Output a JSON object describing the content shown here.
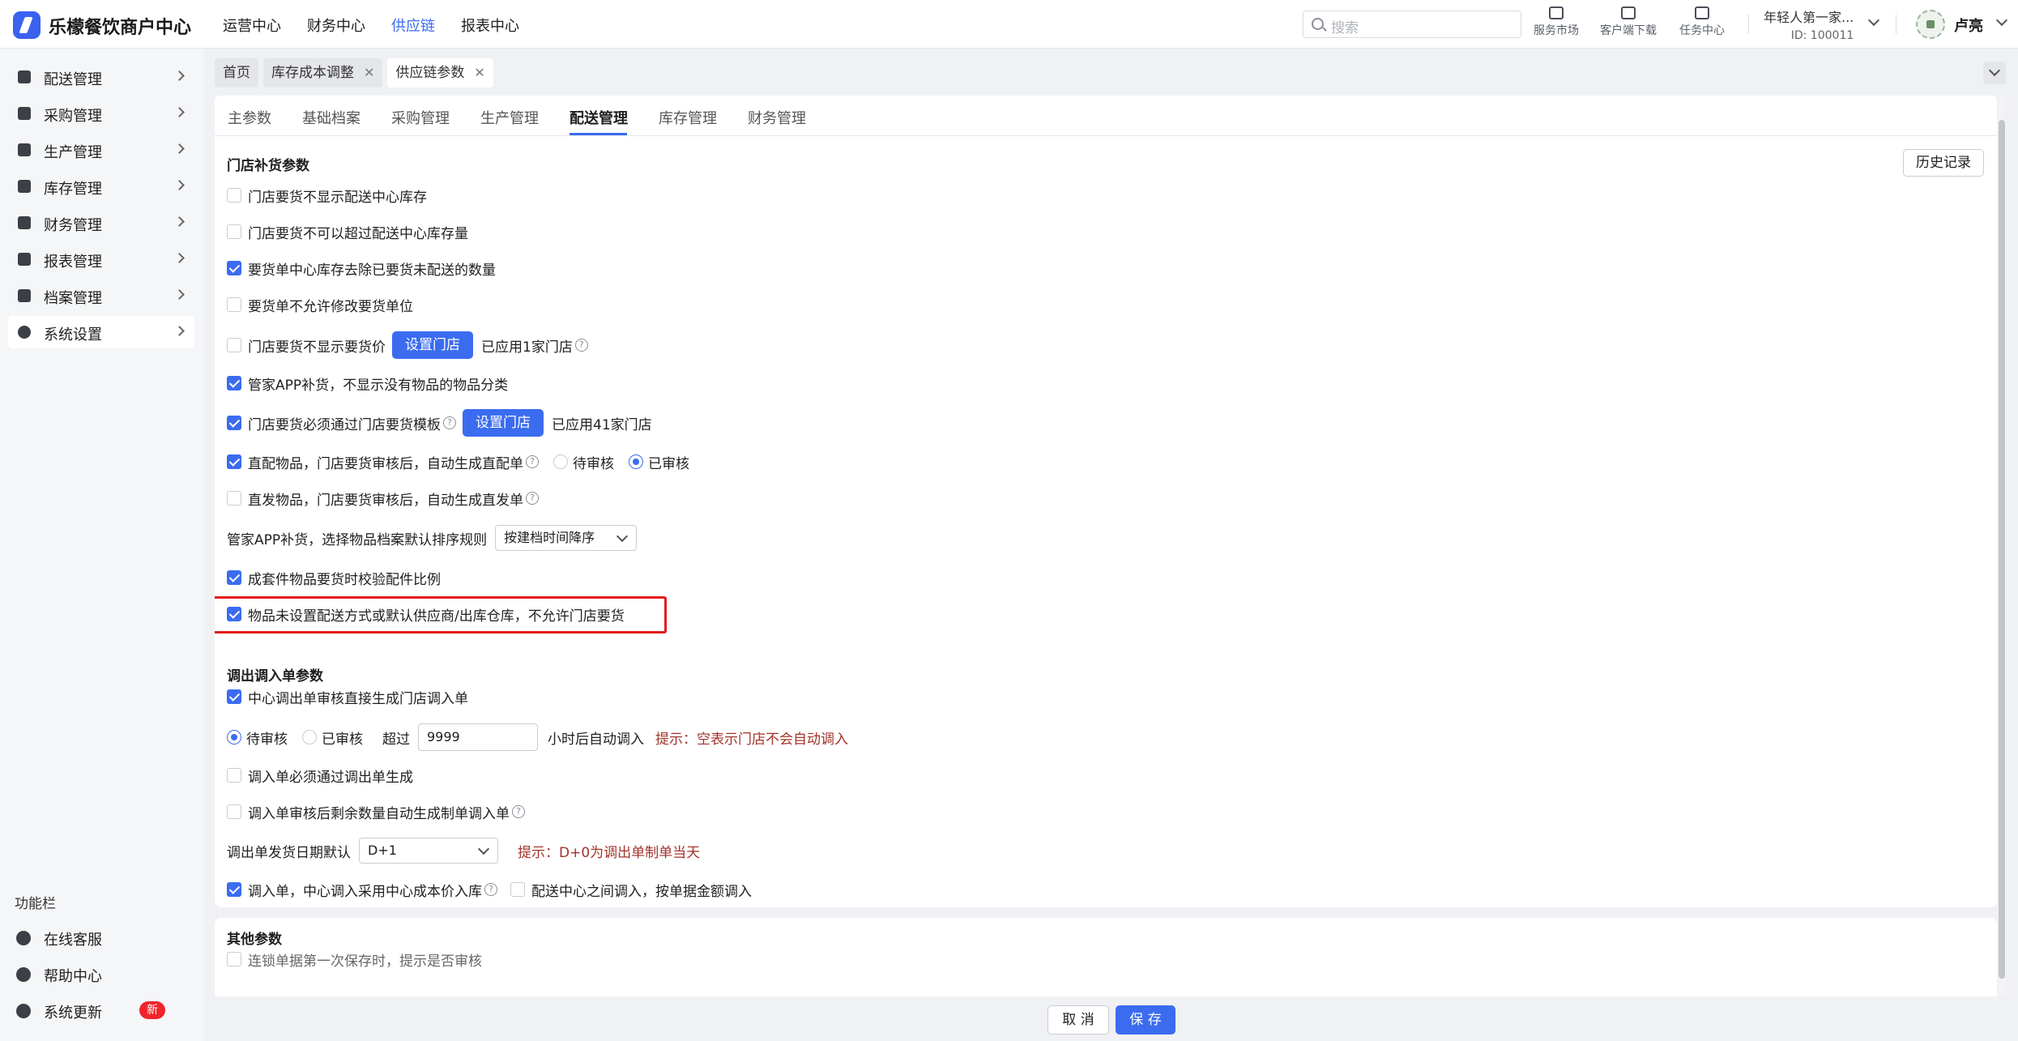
{
  "app": {
    "title": "乐檬餐饮商户中心"
  },
  "topnav": [
    "运营中心",
    "财务中心",
    "供应链",
    "报表中心"
  ],
  "search": {
    "placeholder": "搜索"
  },
  "tools": [
    "服务市场",
    "客户端下载",
    "任务中心"
  ],
  "tenant": {
    "name": "年轻人第一家...",
    "id": "ID: 100011"
  },
  "user": {
    "name": "卢亮"
  },
  "sidebar": {
    "items": [
      "配送管理",
      "采购管理",
      "生产管理",
      "库存管理",
      "财务管理",
      "报表管理",
      "档案管理",
      "系统设置"
    ],
    "func_title": "功能栏",
    "func_items": [
      "在线客服",
      "帮助中心",
      "系统更新"
    ],
    "new_badge": "新"
  },
  "crumbs": [
    "首页",
    "库存成本调整",
    "供应链参数"
  ],
  "tabs": [
    "主参数",
    "基础档案",
    "采购管理",
    "生产管理",
    "配送管理",
    "库存管理",
    "财务管理"
  ],
  "store": {
    "title": "门店补货参数",
    "history": "历史记录",
    "r1": "门店要货不显示配送中心库存",
    "r2": "门店要货不可以超过配送中心库存量",
    "r3": "要货单中心库存去除已要货未配送的数量",
    "r4": "要货单不允许修改要货单位",
    "r5": "门店要货不显示要货价",
    "set_store": "设置门店",
    "r5_applied": "已应用1家门店",
    "r6": "管家APP补货，不显示没有物品的物品分类",
    "r7": "门店要货必须通过门店要货模板",
    "r7_applied": "已应用41家门店",
    "r8": "直配物品，门店要货审核后，自动生成直配单",
    "pending": "待审核",
    "approved": "已审核",
    "r9": "直发物品，门店要货审核后，自动生成直发单",
    "r10": "管家APP补货，选择物品档案默认排序规则",
    "r10_select": "按建档时间降序",
    "r11": "成套件物品要货时校验配件比例",
    "r12": "物品未设置配送方式或默认供应商/出库仓库，不允许门店要货"
  },
  "transfer": {
    "title": "调出调入单参数",
    "r1": "中心调出单审核直接生成门店调入单",
    "pending": "待审核",
    "approved": "已审核",
    "over": "超过",
    "hours_value": "9999",
    "hours_suffix": "小时后自动调入",
    "hint1": "提示：空表示门店不会自动调入",
    "r3": "调入单必须通过调出单生成",
    "r4": "调入单审核后剩余数量自动生成制单调入单",
    "r5": "调出单发货日期默认",
    "r5_select": "D+1",
    "hint2": "提示：D+0为调出单制单当天",
    "r6": "调入单，中心调入采用中心成本价入库",
    "r6b": "配送中心之间调入，按单据金额调入"
  },
  "other": {
    "title": "其他参数",
    "r1": "连锁单据第一次保存时，提示是否审核"
  },
  "footer": {
    "cancel": "取 消",
    "save": "保 存"
  },
  "colors": {
    "accent": "#3b6cf0",
    "highlight": "#e41d1d",
    "hint": "#a3322a"
  }
}
